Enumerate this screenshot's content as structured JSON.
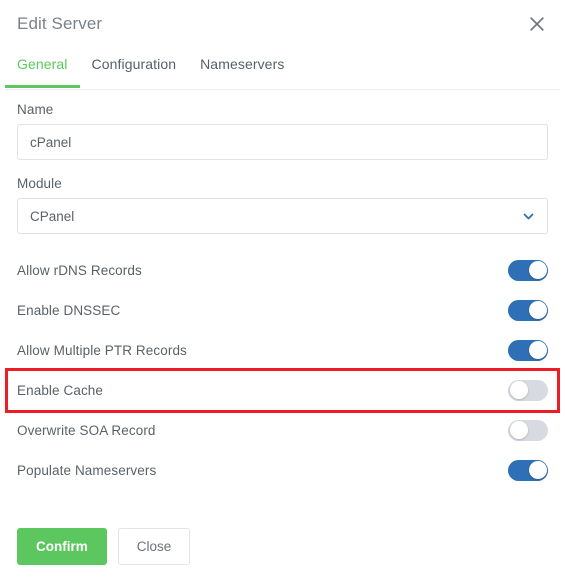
{
  "header": {
    "title": "Edit Server",
    "close_icon": "close-icon"
  },
  "tabs": [
    {
      "label": "General",
      "active": true
    },
    {
      "label": "Configuration",
      "active": false
    },
    {
      "label": "Nameservers",
      "active": false
    }
  ],
  "fields": {
    "name": {
      "label": "Name",
      "value": "cPanel",
      "placeholder": "Name"
    },
    "module": {
      "label": "Module",
      "value": "CPanel",
      "chevron_icon": "chevron-down-icon"
    }
  },
  "toggles": [
    {
      "label": "Allow rDNS Records",
      "on": true
    },
    {
      "label": "Enable DNSSEC",
      "on": true
    },
    {
      "label": "Allow Multiple PTR Records",
      "on": true
    },
    {
      "label": "Enable Cache",
      "on": false,
      "highlighted": true
    },
    {
      "label": "Overwrite SOA Record",
      "on": false
    },
    {
      "label": "Populate Nameservers",
      "on": true
    }
  ],
  "footer": {
    "confirm_label": "Confirm",
    "close_label": "Close"
  },
  "colors": {
    "accent_green": "#5cc75f",
    "toggle_on_blue": "#2f6fb5",
    "toggle_off_gray": "#d7dae1",
    "highlight_red": "#ee1c25",
    "text_gray": "#5b6167"
  }
}
